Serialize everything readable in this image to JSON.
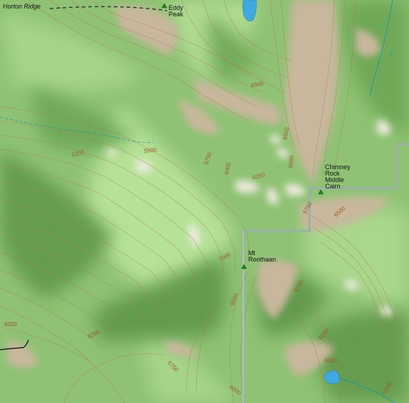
{
  "map": {
    "region_labels": [
      {
        "id": "horton-ridge",
        "text": "Horton Ridge"
      }
    ],
    "peaks": [
      {
        "id": "eddy-peak",
        "text": "Eddy\nPeak"
      },
      {
        "id": "chimney-rock",
        "text": "Chimney\nRock\nMiddle\nCairn"
      },
      {
        "id": "mt-roothaan",
        "text": "Mt\nRoothaan"
      }
    ],
    "contour_labels": [
      {
        "id": "c1",
        "text": "6500"
      },
      {
        "id": "c2",
        "text": "6500"
      },
      {
        "id": "c3",
        "text": "6500"
      },
      {
        "id": "c4",
        "text": "5250"
      },
      {
        "id": "c5",
        "text": "5500"
      },
      {
        "id": "c6",
        "text": "5750"
      },
      {
        "id": "c7",
        "text": "6000"
      },
      {
        "id": "c8",
        "text": "6250"
      },
      {
        "id": "c9",
        "text": "6750"
      },
      {
        "id": "c10",
        "text": "6500"
      },
      {
        "id": "c11",
        "text": "7000"
      },
      {
        "id": "c12",
        "text": "6750"
      },
      {
        "id": "c13",
        "text": "6500"
      },
      {
        "id": "c14",
        "text": "6000"
      },
      {
        "id": "c15",
        "text": "6250"
      },
      {
        "id": "c16",
        "text": "6250"
      },
      {
        "id": "c17",
        "text": "5750"
      },
      {
        "id": "c18",
        "text": "6000"
      },
      {
        "id": "c19",
        "text": "6000"
      },
      {
        "id": "c20",
        "text": "5500"
      }
    ],
    "colors": {
      "vegetation": "#8fc274",
      "shade": "#5f9648",
      "rock": "#c8b79c",
      "snow": "#eceadc",
      "water": "#3fa9e0",
      "contour": "#b07a52",
      "boundary": "#9ab0a8",
      "stream": "#1a9b9b"
    }
  }
}
